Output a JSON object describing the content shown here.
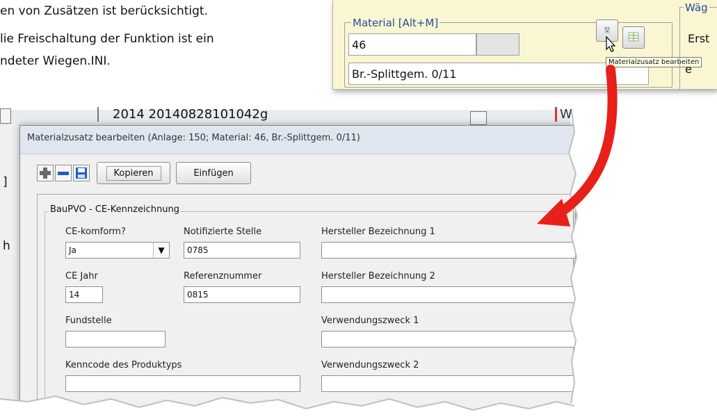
{
  "document": {
    "line1": "en von Zusätzen ist berücksichtigt.",
    "line2": "lie Freischaltung der Funktion ist ein",
    "line3": "ndeter Wiegen.INI."
  },
  "inset": {
    "group_title": "Material [Alt+M]",
    "material_number": "46",
    "material_name": "Br.-Splittgem. 0/11",
    "tooltip": "Materialzusatz bearbeiten",
    "right_group_title": "Wäg",
    "right_group_text": "Erst",
    "right_group_text2": "e"
  },
  "background": {
    "strip_text": "2014 20140828101042g",
    "strip_right": "W",
    "left_items": [
      "]",
      "h"
    ]
  },
  "dialog": {
    "title": "Materialzusatz bearbeiten (Anlage: 150; Material: 46, Br.-Splittgem. 0/11)",
    "copy_label": "Kopieren",
    "paste_label": "Einfügen",
    "group_title": "BauPVO - CE-Kennzeichnung",
    "ce_conform_label": "CE-komform?",
    "ce_conform_value": "Ja",
    "notified_body_label": "Notifizierte Stelle",
    "notified_body_value": "0785",
    "manufacturer_1_label": "Hersteller Bezeichnung 1",
    "manufacturer_1_value": "",
    "ce_year_label": "CE Jahr",
    "ce_year_value": "14",
    "reference_label": "Referenznummer",
    "reference_value": "0815",
    "manufacturer_2_label": "Hersteller Bezeichnung 2",
    "manufacturer_2_value": "",
    "source_label": "Fundstelle",
    "source_value": "",
    "purpose_1_label": "Verwendungszweck 1",
    "purpose_1_value": "",
    "product_code_label": "Kenncode des Produktyps",
    "product_code_value": "",
    "purpose_2_label": "Verwendungszweck 2",
    "purpose_2_value": ""
  },
  "colors": {
    "arrow": "#e8201a",
    "inset_bg": "#fbf6d2",
    "label_blue": "#1f4e9b"
  },
  "icons": [
    "plus-icon",
    "minus-icon",
    "save-icon",
    "material-addon-icon",
    "table-icon",
    "cursor-icon"
  ]
}
